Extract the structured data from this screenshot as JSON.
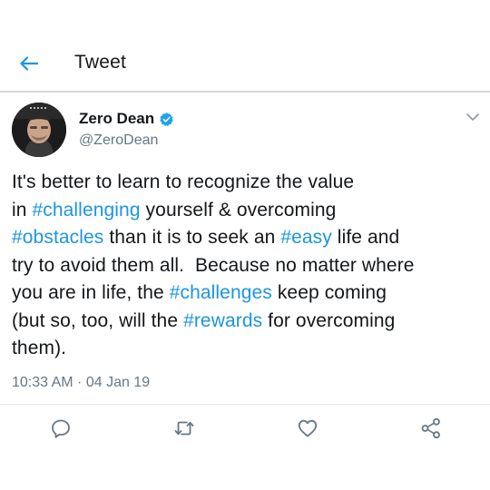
{
  "header": {
    "title": "Tweet"
  },
  "author": {
    "name": "Zero Dean",
    "handle": "@ZeroDean"
  },
  "tweet": {
    "lines": [
      [
        {
          "t": "It's better to learn to recognize the value"
        }
      ],
      [
        {
          "t": "in "
        },
        {
          "t": "#challenging",
          "tag": true
        },
        {
          "t": " yourself & overcoming"
        }
      ],
      [
        {
          "t": "#obstacles",
          "tag": true
        },
        {
          "t": " than it is to seek an "
        },
        {
          "t": "#easy",
          "tag": true
        },
        {
          "t": " life and"
        }
      ],
      [
        {
          "t": "try to avoid them all.  Because no matter where"
        }
      ],
      [
        {
          "t": "you are in life, the "
        },
        {
          "t": "#challenges",
          "tag": true
        },
        {
          "t": " keep coming"
        }
      ],
      [
        {
          "t": "(but so, too, will the "
        },
        {
          "t": "#rewards",
          "tag": true
        },
        {
          "t": " for overcoming"
        }
      ],
      [
        {
          "t": "them)."
        }
      ]
    ],
    "timestamp": "10:33 AM · 04 Jan 19"
  },
  "icons": {
    "back": "arrow-left-icon",
    "verified": "verified-badge-icon",
    "menu": "chevron-down-icon",
    "reply": "reply-icon",
    "retweet": "retweet-icon",
    "like": "heart-icon",
    "share": "share-icon"
  },
  "colors": {
    "accent": "#1b95e0",
    "text": "#14171a",
    "secondary": "#657786",
    "icon": "#657786"
  }
}
